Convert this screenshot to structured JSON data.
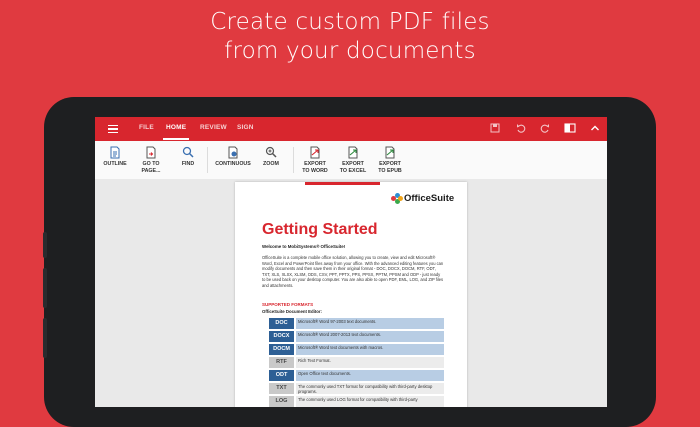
{
  "promo": {
    "line1": "Create custom PDF files",
    "line2": "from your documents"
  },
  "menu": {
    "tabs": [
      "FILE",
      "HOME",
      "REVIEW",
      "SIGN"
    ],
    "active_tab": "HOME"
  },
  "ribbon": {
    "outline": "OUTLINE",
    "goto": "GO TO\nPAGE...",
    "find": "FIND",
    "continuous": "CONTINUOUS",
    "zoom": "ZOOM",
    "export_word": "EXPORT\nTO WORD",
    "export_excel": "EXPORT\nTO EXCEL",
    "export_epub": "EXPORT\nTO EPUB"
  },
  "document": {
    "logo_text": "OfficeSuite",
    "title": "Getting Started",
    "welcome": "Welcome to MobiSystems® OfficeSuite!",
    "paragraph": "OfficeSuite is a complete mobile office solution, allowing you to create, view and edit Microsoft® Word, Excel and PowerPoint files away from your office. With the advanced editing features you can modify documents and then save them in their original format - DOC, DOCX, DOCM, RTF, ODT, TXT, XLS, XLSX, XLSM, ODS, CSV, PPT, PPTX, PPS, PPSX, PPTM, PPSM and ODP - just ready to be used back on your desktop computer. You are also able to open PDF, EML, LOG, and ZIP files and attachments.",
    "section": "SUPPORTED FORMATS",
    "subsection": "OfficeSuite Document Editor:",
    "formats": [
      {
        "code": "DOC",
        "desc": "Microsoft® Word 97-2003 text documents.",
        "code_color": "#2d5f95",
        "row_color": "#b8cde4"
      },
      {
        "code": "DOCX",
        "desc": "Microsoft® Word 2007-2013 text documents.",
        "code_color": "#2d5f95",
        "row_color": "#b8cde4"
      },
      {
        "code": "DOCM",
        "desc": "Microsoft® Word text documents with macros.",
        "code_color": "#2d5f95",
        "row_color": "#b8cde4"
      },
      {
        "code": "RTF",
        "desc": "Rich Text Format.",
        "code_color": "#c9c9c9",
        "row_color": "#ececec"
      },
      {
        "code": "ODT",
        "desc": "Open Office text documents.",
        "code_color": "#2d5f95",
        "row_color": "#b8cde4"
      },
      {
        "code": "TXT",
        "desc": "The commonly used TXT format for compatibility with third-party desktop programs.",
        "code_color": "#c9c9c9",
        "row_color": "#ececec"
      },
      {
        "code": "LOG",
        "desc": "The commonly used LOG format for compatibility with third-party",
        "code_color": "#c9c9c9",
        "row_color": "#ececec"
      }
    ]
  },
  "colors": {
    "background": "#e03a40",
    "toolbar": "#d8262e",
    "accent_red": "#d8262e",
    "format_blue": "#2d5f95"
  }
}
